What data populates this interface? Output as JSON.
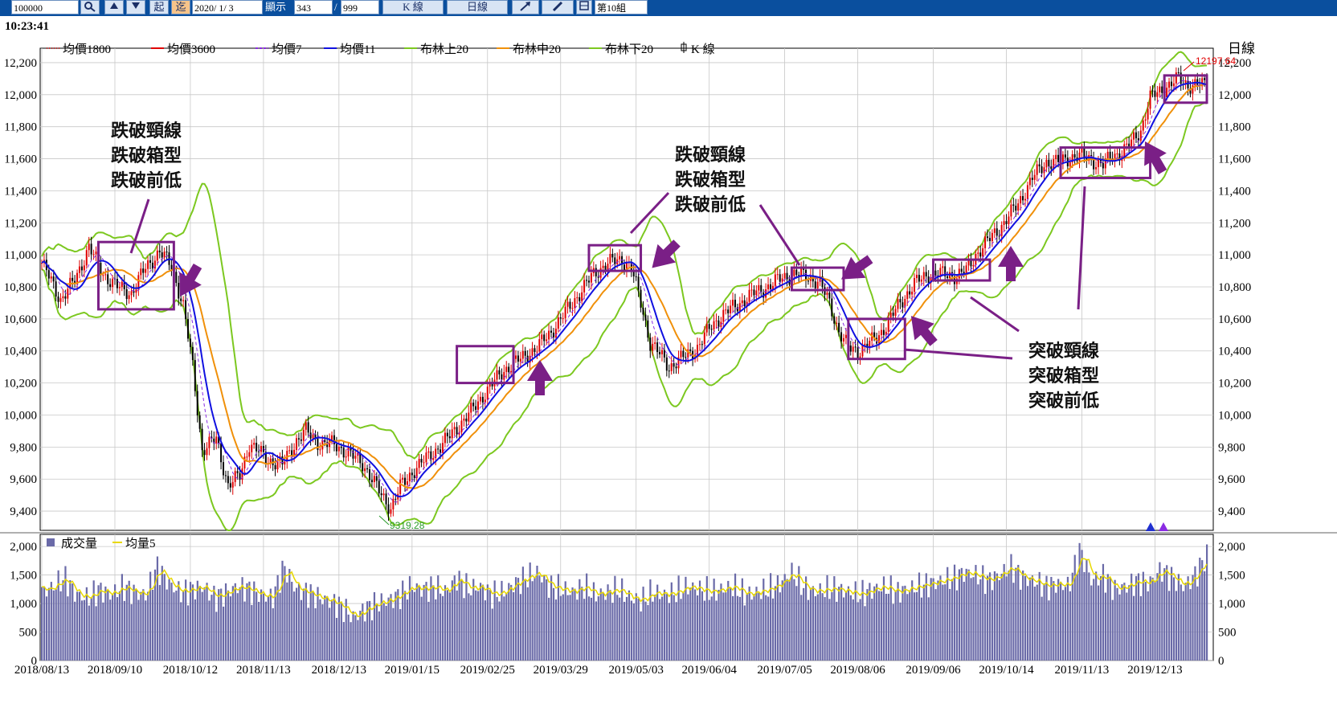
{
  "toolbar": {
    "code_value": "100000",
    "date_value": "2020/ 1/ 3",
    "display_label": "顯示",
    "display_value": "343",
    "total_value": "999",
    "qi_label": "起",
    "zhi_label": "迄",
    "kline_label": "K 線",
    "period_label": "日線",
    "group_label": "第10組"
  },
  "header": {
    "time": "10:23:41"
  },
  "price_legend": [
    {
      "name": "均價1800",
      "color": "#e03030",
      "style": "dotted"
    },
    {
      "name": "均價3600",
      "color": "#e00000",
      "style": "solid"
    },
    {
      "name": "均價7",
      "color": "#8a2be2",
      "style": "dashed"
    },
    {
      "name": "均價11",
      "color": "#1010e0",
      "style": "solid"
    },
    {
      "name": "布林上20",
      "color": "#7cc820",
      "style": "solid"
    },
    {
      "name": "布林中20",
      "color": "#f0900a",
      "style": "solid"
    },
    {
      "name": "布林下20",
      "color": "#7cc820",
      "style": "solid"
    },
    {
      "name": "K 線",
      "color": "#000000",
      "style": "icon"
    }
  ],
  "period_badge": "日線",
  "volume_legend": [
    {
      "name": "成交量",
      "color": "#6a6aa8"
    },
    {
      "name": "均量5",
      "color": "#e8d800"
    }
  ],
  "annotations": {
    "left_text": [
      "跌破頸線",
      "跌破箱型",
      "跌破前低"
    ],
    "mid_text": [
      "跌破頸線",
      "跌破箱型",
      "跌破前低"
    ],
    "right_text": [
      "突破頸線",
      "突破箱型",
      "突破前低"
    ]
  },
  "chart_data": {
    "type": "candlestick",
    "price_axis": {
      "ticks": [
        "12,200",
        "12,000",
        "11,800",
        "11,600",
        "11,400",
        "11,200",
        "11,000",
        "10,800",
        "10,600",
        "10,400",
        "10,200",
        "10,000",
        "9,800",
        "9,600",
        "9,400"
      ],
      "ylim": [
        9280,
        12290
      ]
    },
    "volume_axis": {
      "ticks": [
        "2,000",
        "1,500",
        "1,000",
        "500",
        "0"
      ],
      "ylim": [
        0,
        2100
      ]
    },
    "x_labels": [
      "2018/08/13",
      "2018/09/10",
      "2018/10/12",
      "2018/11/13",
      "2018/12/13",
      "2019/01/15",
      "2019/02/25",
      "2019/03/29",
      "2019/05/03",
      "2019/06/04",
      "2019/07/05",
      "2019/08/06",
      "2019/09/06",
      "2019/10/14",
      "2019/11/13",
      "2019/12/13"
    ],
    "max_label": "12197.64",
    "min_label": "9319.28",
    "close_path": [
      [
        0,
        10950
      ],
      [
        8,
        10720
      ],
      [
        14,
        10840
      ],
      [
        20,
        11050
      ],
      [
        26,
        10880
      ],
      [
        32,
        10800
      ],
      [
        38,
        10760
      ],
      [
        44,
        10920
      ],
      [
        50,
        11020
      ],
      [
        55,
        10930
      ],
      [
        60,
        10680
      ],
      [
        64,
        10300
      ],
      [
        68,
        9780
      ],
      [
        74,
        9850
      ],
      [
        79,
        9560
      ],
      [
        84,
        9620
      ],
      [
        88,
        9820
      ],
      [
        96,
        9720
      ],
      [
        102,
        9690
      ],
      [
        108,
        9840
      ],
      [
        112,
        9900
      ],
      [
        118,
        9820
      ],
      [
        124,
        9820
      ],
      [
        130,
        9760
      ],
      [
        136,
        9700
      ],
      [
        140,
        9600
      ],
      [
        144,
        9500
      ],
      [
        148,
        9420
      ],
      [
        152,
        9550
      ],
      [
        158,
        9660
      ],
      [
        164,
        9740
      ],
      [
        170,
        9820
      ],
      [
        176,
        9920
      ],
      [
        182,
        10020
      ],
      [
        188,
        10140
      ],
      [
        196,
        10280
      ],
      [
        204,
        10360
      ],
      [
        210,
        10420
      ],
      [
        216,
        10520
      ],
      [
        222,
        10640
      ],
      [
        228,
        10760
      ],
      [
        234,
        10880
      ],
      [
        240,
        10950
      ],
      [
        246,
        10970
      ],
      [
        250,
        10920
      ],
      [
        254,
        10700
      ],
      [
        258,
        10450
      ],
      [
        262,
        10380
      ],
      [
        266,
        10300
      ],
      [
        272,
        10360
      ],
      [
        278,
        10420
      ],
      [
        284,
        10560
      ],
      [
        290,
        10640
      ],
      [
        296,
        10700
      ],
      [
        302,
        10760
      ],
      [
        308,
        10800
      ],
      [
        314,
        10860
      ],
      [
        320,
        10880
      ],
      [
        326,
        10860
      ],
      [
        330,
        10820
      ],
      [
        334,
        10700
      ],
      [
        338,
        10520
      ],
      [
        342,
        10420
      ],
      [
        346,
        10400
      ],
      [
        350,
        10440
      ],
      [
        354,
        10480
      ],
      [
        358,
        10560
      ],
      [
        364,
        10700
      ],
      [
        370,
        10820
      ],
      [
        376,
        10880
      ],
      [
        382,
        10880
      ],
      [
        388,
        10870
      ],
      [
        392,
        10900
      ],
      [
        396,
        11000
      ],
      [
        402,
        11100
      ],
      [
        408,
        11200
      ],
      [
        414,
        11320
      ],
      [
        420,
        11480
      ],
      [
        426,
        11580
      ],
      [
        432,
        11580
      ],
      [
        438,
        11620
      ],
      [
        444,
        11600
      ],
      [
        450,
        11560
      ],
      [
        454,
        11620
      ],
      [
        458,
        11640
      ],
      [
        462,
        11700
      ],
      [
        466,
        11780
      ],
      [
        470,
        11980
      ],
      [
        476,
        12040
      ],
      [
        482,
        12100
      ],
      [
        486,
        12060
      ],
      [
        490,
        12060
      ]
    ],
    "volume_levels": [
      1200,
      1300,
      1450,
      1150,
      1100,
      1250,
      1150,
      1300,
      1200,
      1150,
      1650,
      1350,
      1200,
      1250,
      1300,
      1100,
      1200,
      1300,
      1250,
      1150,
      1100,
      1650,
      1250,
      1200,
      1100,
      1050,
      950,
      750,
      900,
      1000,
      1050,
      1150,
      1300,
      1250,
      1300,
      1200,
      1450,
      1250,
      1300,
      1150,
      1200,
      1350,
      1450,
      1550,
      1300,
      1250,
      1200,
      1300,
      1150,
      1200,
      1250,
      1100,
      1050,
      1200,
      1150,
      1200,
      1300,
      1250,
      1200,
      1250,
      1300,
      1150,
      1200,
      1250,
      1350,
      1550,
      1300,
      1200,
      1250,
      1250,
      1200,
      1150,
      1250,
      1300,
      1200,
      1250,
      1300,
      1350,
      1400,
      1450,
      1550,
      1500,
      1400,
      1500,
      1650,
      1450,
      1400,
      1300,
      1350,
      1300,
      1950,
      1400,
      1500,
      1250,
      1300,
      1400,
      1350,
      1600,
      1450,
      1300,
      1500,
      1850
    ],
    "boxes": [
      {
        "i0": 24,
        "i1": 56,
        "p0": 10660,
        "p1": 11080
      },
      {
        "i0": 176,
        "i1": 200,
        "p0": 10200,
        "p1": 10430
      },
      {
        "i0": 232,
        "i1": 254,
        "p0": 10900,
        "p1": 11060
      },
      {
        "i0": 318,
        "i1": 340,
        "p0": 10780,
        "p1": 10920
      },
      {
        "i0": 342,
        "i1": 366,
        "p0": 10350,
        "p1": 10600
      },
      {
        "i0": 378,
        "i1": 402,
        "p0": 10840,
        "p1": 10970
      },
      {
        "i0": 432,
        "i1": 470,
        "p0": 11480,
        "p1": 11670
      },
      {
        "i0": 476,
        "i1": 494,
        "p0": 11950,
        "p1": 12120
      }
    ]
  }
}
